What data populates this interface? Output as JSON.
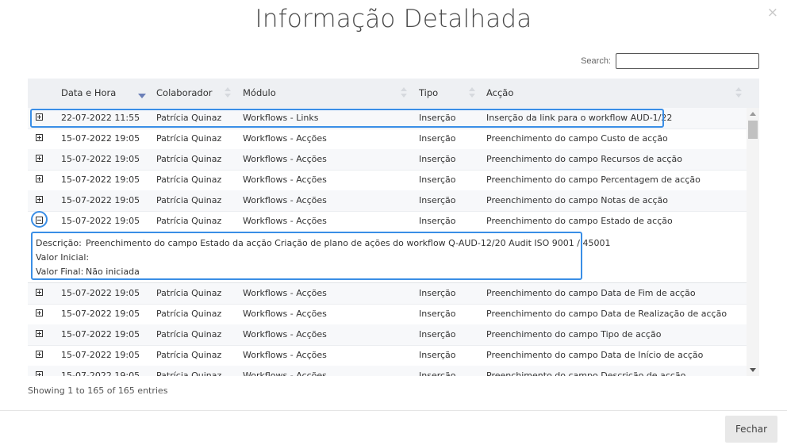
{
  "modal": {
    "title": "Informação Detalhada",
    "close_icon": "×"
  },
  "search": {
    "label": "Search:",
    "value": ""
  },
  "columns": [
    "Data e Hora",
    "Colaborador",
    "Módulo",
    "Tipo",
    "Acção"
  ],
  "sort": {
    "column": "Data e Hora",
    "direction": "desc"
  },
  "rows": [
    {
      "date": "22-07-2022 11:55",
      "user": "Patrícia Quinaz",
      "module": "Workflows - Links",
      "type": "Inserção",
      "action": "Inserção da link para o workflow AUD-1/22",
      "expanded": false
    },
    {
      "date": "15-07-2022 19:05",
      "user": "Patrícia Quinaz",
      "module": "Workflows - Acções",
      "type": "Inserção",
      "action": "Preenchimento do campo Custo de acção",
      "expanded": false
    },
    {
      "date": "15-07-2022 19:05",
      "user": "Patrícia Quinaz",
      "module": "Workflows - Acções",
      "type": "Inserção",
      "action": "Preenchimento do campo Recursos de acção",
      "expanded": false
    },
    {
      "date": "15-07-2022 19:05",
      "user": "Patrícia Quinaz",
      "module": "Workflows - Acções",
      "type": "Inserção",
      "action": "Preenchimento do campo Percentagem de acção",
      "expanded": false
    },
    {
      "date": "15-07-2022 19:05",
      "user": "Patrícia Quinaz",
      "module": "Workflows - Acções",
      "type": "Inserção",
      "action": "Preenchimento do campo Notas de acção",
      "expanded": false
    },
    {
      "date": "15-07-2022 19:05",
      "user": "Patrícia Quinaz",
      "module": "Workflows - Acções",
      "type": "Inserção",
      "action": "Preenchimento do campo Estado de acção",
      "expanded": true
    },
    {
      "date": "15-07-2022 19:05",
      "user": "Patrícia Quinaz",
      "module": "Workflows - Acções",
      "type": "Inserção",
      "action": "Preenchimento do campo Data de Fim de acção",
      "expanded": false
    },
    {
      "date": "15-07-2022 19:05",
      "user": "Patrícia Quinaz",
      "module": "Workflows - Acções",
      "type": "Inserção",
      "action": "Preenchimento do campo Data de Realização de acção",
      "expanded": false
    },
    {
      "date": "15-07-2022 19:05",
      "user": "Patrícia Quinaz",
      "module": "Workflows - Acções",
      "type": "Inserção",
      "action": "Preenchimento do campo Tipo de acção",
      "expanded": false
    },
    {
      "date": "15-07-2022 19:05",
      "user": "Patrícia Quinaz",
      "module": "Workflows - Acções",
      "type": "Inserção",
      "action": "Preenchimento do campo Data de Início de acção",
      "expanded": false
    },
    {
      "date": "15-07-2022 19:05",
      "user": "Patrícia Quinaz",
      "module": "Workflows - Acções",
      "type": "Inserção",
      "action": "Preenchimento do campo Descrição de acção",
      "expanded": false
    }
  ],
  "detail": {
    "descricao_label": "Descrição:",
    "descricao_value": "Preenchimento do campo Estado da acção Criação de plano de ações do workflow Q-AUD-12/20 Audit ISO 9001 / 45001",
    "valor_inicial_label": "Valor Inicial:",
    "valor_inicial_value": "",
    "valor_final_label": "Valor Final:",
    "valor_final_value": "Não iniciada"
  },
  "info": "Showing 1 to 165 of 165 entries",
  "footer": {
    "close_label": "Fechar"
  },
  "colors": {
    "highlight": "#3a8ee6",
    "header_bg": "#eef0f3",
    "sort_active": "#6b7fb8"
  }
}
